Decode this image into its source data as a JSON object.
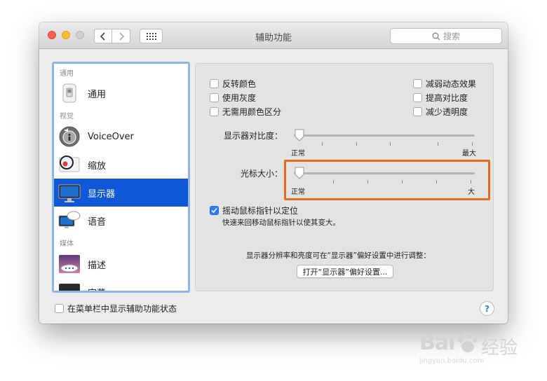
{
  "window": {
    "title": "辅助功能",
    "search_placeholder": "搜索"
  },
  "sidebar": {
    "sections": {
      "general": "通用",
      "vision": "视觉",
      "media": "媒体"
    },
    "items": [
      {
        "label": "通用",
        "icon": "switch-icon"
      },
      {
        "label": "VoiceOver",
        "icon": "voiceover-icon"
      },
      {
        "label": "缩放",
        "icon": "zoom-icon"
      },
      {
        "label": "显示器",
        "icon": "display-icon",
        "selected": true
      },
      {
        "label": "语音",
        "icon": "speech-icon"
      },
      {
        "label": "描述",
        "icon": "descriptions-icon"
      },
      {
        "label": "字幕",
        "icon": "captions-icon"
      }
    ]
  },
  "panel": {
    "checkboxes_left": [
      {
        "label": "反转颜色",
        "checked": false
      },
      {
        "label": "使用灰度",
        "checked": false
      },
      {
        "label": "无需用颜色区分",
        "checked": false
      }
    ],
    "checkboxes_right": [
      {
        "label": "减弱动态效果",
        "checked": false
      },
      {
        "label": "提高对比度",
        "checked": false
      },
      {
        "label": "减少透明度",
        "checked": false
      }
    ],
    "contrast": {
      "label": "显示器对比度：",
      "min_label": "正常",
      "max_label": "最大",
      "value": 0
    },
    "cursor": {
      "label": "光标大小：",
      "min_label": "正常",
      "max_label": "大",
      "value": 0
    },
    "shake": {
      "label": "摇动鼠标指针以定位",
      "checked": true,
      "description": "快速来回移动鼠标指针以使其变大。"
    },
    "note": "显示器分辨率和亮度可在“显示器”偏好设置中进行调整：",
    "open_button": "打开“显示器”偏好设置..."
  },
  "footer": {
    "menubar_checkbox": "在菜单栏中显示辅助功能状态",
    "help": "?"
  },
  "watermark": {
    "brand": "Bai",
    "cn": "经验",
    "url": "jingyan.baidu.com"
  },
  "colors": {
    "selection": "#0f59d8",
    "highlight": "#e56a1e",
    "checkbox_checked": "#2b7ef7"
  }
}
